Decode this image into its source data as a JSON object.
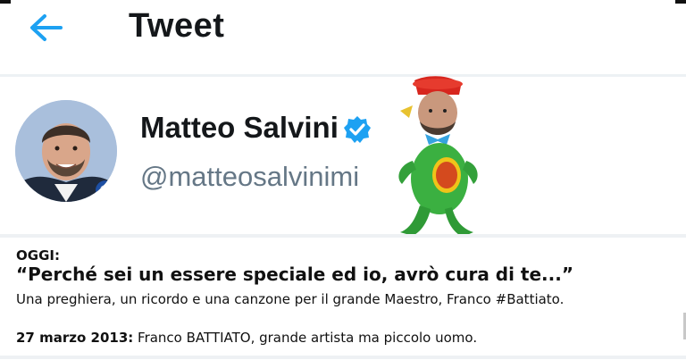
{
  "header": {
    "back_icon": "arrow-left-icon",
    "title": "Tweet"
  },
  "profile": {
    "name": "Matteo Salvini",
    "handle": "@matteosalvinimi",
    "verified_icon": "verified-badge-icon"
  },
  "caption": {
    "label": "OGGI:",
    "quote": "“Perché sei un essere speciale ed io, avrò cura di te...”",
    "subtitle": "Una preghiera, un ricordo e una canzone per il grande Maestro, Franco #Battiato.",
    "date": "27 marzo 2013:",
    "old_tweet": "Franco BATTIATO, grande artista ma piccolo uomo."
  },
  "colors": {
    "accent": "#1da1f2",
    "text": "#14171a",
    "secondary": "#657786"
  }
}
